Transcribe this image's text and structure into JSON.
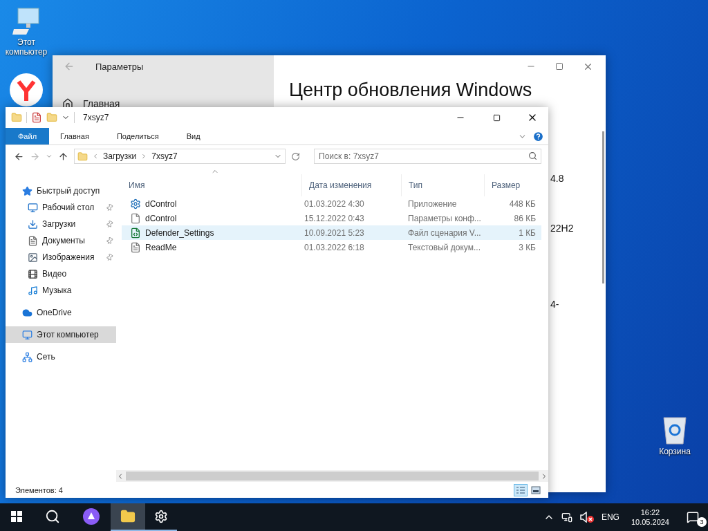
{
  "desktop_icons": [
    {
      "kind": "computer",
      "label": "Этот компьютер"
    },
    {
      "kind": "browser"
    },
    {
      "kind": "bin",
      "label": "Корзина"
    }
  ],
  "settings_window": {
    "title": "Параметры",
    "nav_item": "Главная",
    "heading": "Центр обновления Windows",
    "fragments": [
      "4.8",
      "22H2",
      "4-"
    ]
  },
  "explorer": {
    "title": "7xsyz7",
    "ribbon_tabs": [
      {
        "label": "Файл",
        "selected": true
      },
      {
        "label": "Главная",
        "selected": false
      },
      {
        "label": "Поделиться",
        "selected": false
      },
      {
        "label": "Вид",
        "selected": false
      }
    ],
    "path": [
      "Загрузки",
      "7xsyz7"
    ],
    "search": {
      "placeholder": "Поиск в: 7xsyz7"
    },
    "nav": [
      {
        "label": "Быстрый доступ",
        "kind": "star",
        "selected": false,
        "children": [
          {
            "label": "Рабочий стол",
            "kind": "desktop",
            "pinned": true,
            "selected": false
          },
          {
            "label": "Загрузки",
            "kind": "download",
            "pinned": true,
            "selected": false
          },
          {
            "label": "Документы",
            "kind": "document",
            "pinned": true,
            "selected": false
          },
          {
            "label": "Изображения",
            "kind": "image",
            "pinned": true,
            "selected": false
          },
          {
            "label": "Видео",
            "kind": "video",
            "pinned": false,
            "selected": false
          },
          {
            "label": "Музыка",
            "kind": "music",
            "pinned": false,
            "selected": false
          }
        ]
      },
      {
        "label": "OneDrive",
        "kind": "cloud",
        "selected": false
      },
      {
        "label": "Этот компьютер",
        "kind": "computer",
        "selected": true
      },
      {
        "label": "Сеть",
        "kind": "network",
        "selected": false
      }
    ],
    "columns": [
      "Имя",
      "Дата изменения",
      "Тип",
      "Размер"
    ],
    "rows": [
      {
        "kind": "app",
        "name": "dControl",
        "date": "01.03.2022 4:30",
        "type": "Приложение",
        "size": "448 КБ",
        "hovered": false
      },
      {
        "kind": "config",
        "name": "dControl",
        "date": "15.12.2022 0:43",
        "type": "Параметры конф...",
        "size": "86 КБ",
        "hovered": false
      },
      {
        "kind": "script",
        "name": "Defender_Settings",
        "date": "10.09.2021 5:23",
        "type": "Файл сценария V...",
        "size": "1 КБ",
        "hovered": true
      },
      {
        "kind": "text",
        "name": "ReadMe",
        "date": "01.03.2022 6:18",
        "type": "Текстовый докум...",
        "size": "3 КБ",
        "hovered": false
      }
    ],
    "status": "Элементов: 4",
    "views": [
      {
        "kind": "details",
        "selected": true
      },
      {
        "kind": "thumbnails",
        "selected": false
      }
    ]
  },
  "taskbar": {
    "apps": [
      {
        "kind": "start",
        "active": false,
        "running": false
      },
      {
        "kind": "search",
        "active": false,
        "running": false
      },
      {
        "kind": "assistant",
        "active": false,
        "running": false
      },
      {
        "kind": "explorer",
        "active": true,
        "running": true
      },
      {
        "kind": "settings",
        "active": false,
        "running": true
      }
    ],
    "language": "ENG",
    "time": "16:22",
    "date": "10.05.2024",
    "notifications": "3"
  }
}
